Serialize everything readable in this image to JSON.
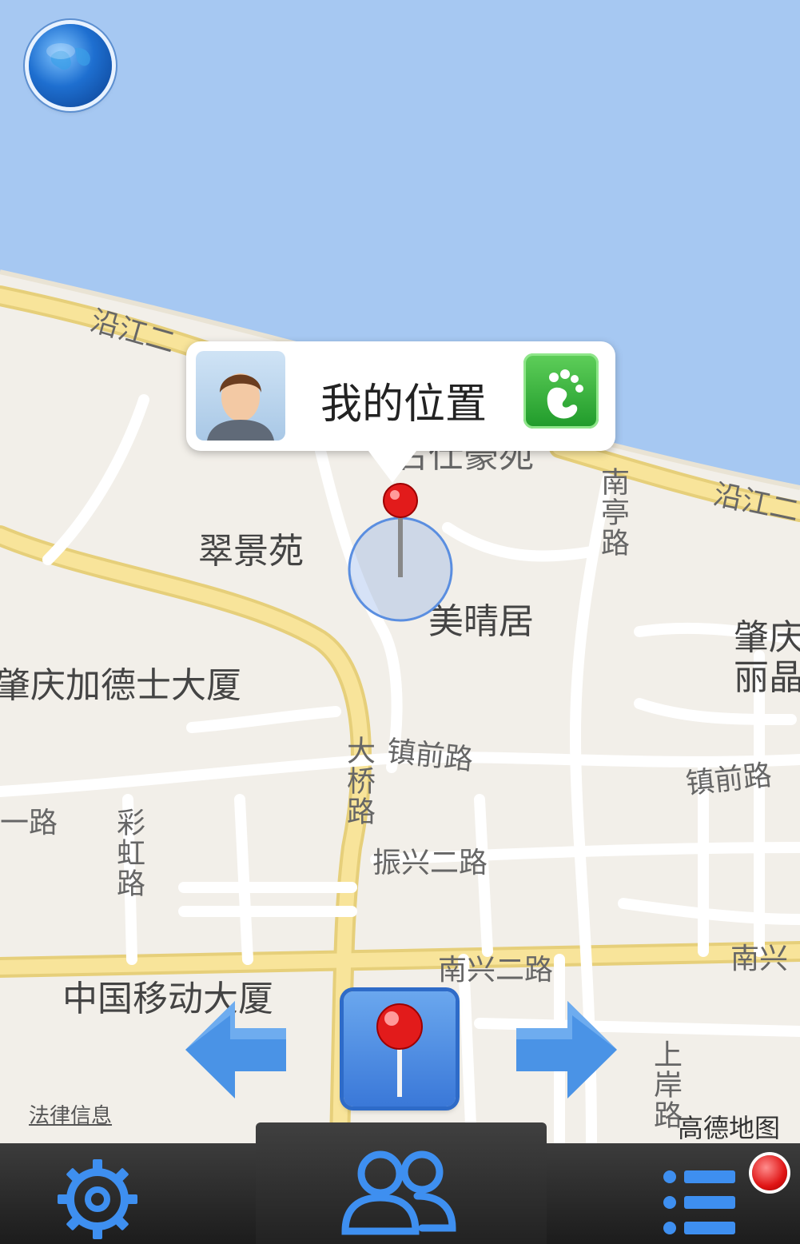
{
  "map": {
    "my_location_title": "我的位置",
    "poi_labels": [
      "名仕豪苑",
      "翠景苑",
      "美晴居",
      "肇庆加德士大厦",
      "中国移动大厦",
      "肇庆",
      "丽晶"
    ],
    "road_labels": [
      "沿江二",
      "沿江二",
      "南亭路",
      "镇前路",
      "镇前路",
      "大桥路",
      "彩虹路",
      "振兴二路",
      "南兴二路",
      "南兴",
      "上岸路",
      "一路"
    ],
    "legal_link": "法律信息",
    "provider_logo": "高德地图"
  },
  "controls": {
    "globe_icon": "globe-icon",
    "prev_icon": "arrow-left-icon",
    "center_icon": "pin-icon",
    "next_icon": "arrow-right-icon",
    "bubble_action_icon": "footprint-icon"
  },
  "toolbar": {
    "settings_icon": "gear-icon",
    "friends_icon": "people-icon",
    "list_icon": "list-icon",
    "notification_badge": "red-dot"
  },
  "colors": {
    "water": "#a6c8f2",
    "land": "#f2efe9",
    "major_road": "#f6de8a",
    "minor_road": "#ffffff",
    "accent": "#3b82e0"
  }
}
